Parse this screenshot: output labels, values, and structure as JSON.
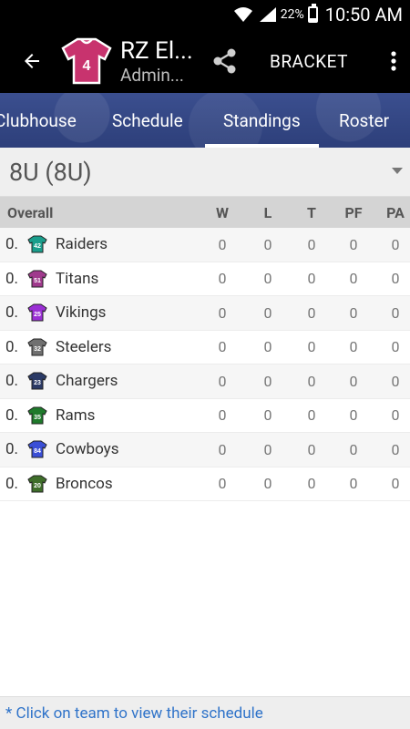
{
  "status_bar": {
    "icons": [
      "wifi-icon",
      "signal-icon",
      "battery-icon"
    ],
    "battery_percent": "22%",
    "battery_level": 0.22,
    "time": "10:50 AM"
  },
  "app_bar": {
    "jersey_number": "4",
    "jersey_color": "#c8336e",
    "title": "RZ El...",
    "subtitle": "Admin...",
    "bracket_label": "BRACKET"
  },
  "tabs": [
    {
      "label": "Clubhouse",
      "active": false
    },
    {
      "label": "Schedule",
      "active": false
    },
    {
      "label": "Standings",
      "active": true
    },
    {
      "label": "Roster",
      "active": false
    }
  ],
  "division": {
    "label": "8U (8U)"
  },
  "table": {
    "headers": {
      "name": "Overall",
      "w": "W",
      "l": "L",
      "t": "T",
      "pf": "PF",
      "pa": "PA"
    },
    "rows": [
      {
        "rank": "0.",
        "team": "Raiders",
        "jersey_number": "42",
        "jersey_color": "#1a9e8c",
        "w": "0",
        "l": "0",
        "t": "0",
        "pf": "0",
        "pa": "0"
      },
      {
        "rank": "0.",
        "team": "Titans",
        "jersey_number": "51",
        "jersey_color": "#a03a8d",
        "w": "0",
        "l": "0",
        "t": "0",
        "pf": "0",
        "pa": "0"
      },
      {
        "rank": "0.",
        "team": "Vikings",
        "jersey_number": "25",
        "jersey_color": "#9a2fd4",
        "w": "0",
        "l": "0",
        "t": "0",
        "pf": "0",
        "pa": "0"
      },
      {
        "rank": "0.",
        "team": "Steelers",
        "jersey_number": "32",
        "jersey_color": "#707070",
        "w": "0",
        "l": "0",
        "t": "0",
        "pf": "0",
        "pa": "0"
      },
      {
        "rank": "0.",
        "team": "Chargers",
        "jersey_number": "23",
        "jersey_color": "#2b3a66",
        "w": "0",
        "l": "0",
        "t": "0",
        "pf": "0",
        "pa": "0"
      },
      {
        "rank": "0.",
        "team": "Rams",
        "jersey_number": "35",
        "jersey_color": "#1f7a2b",
        "w": "0",
        "l": "0",
        "t": "0",
        "pf": "0",
        "pa": "0"
      },
      {
        "rank": "0.",
        "team": "Cowboys",
        "jersey_number": "84",
        "jersey_color": "#3b4fd6",
        "w": "0",
        "l": "0",
        "t": "0",
        "pf": "0",
        "pa": "0"
      },
      {
        "rank": "0.",
        "team": "Broncos",
        "jersey_number": "20",
        "jersey_color": "#3f6e2a",
        "w": "0",
        "l": "0",
        "t": "0",
        "pf": "0",
        "pa": "0"
      }
    ]
  },
  "footer": {
    "text": "* Click on team to view their schedule"
  }
}
